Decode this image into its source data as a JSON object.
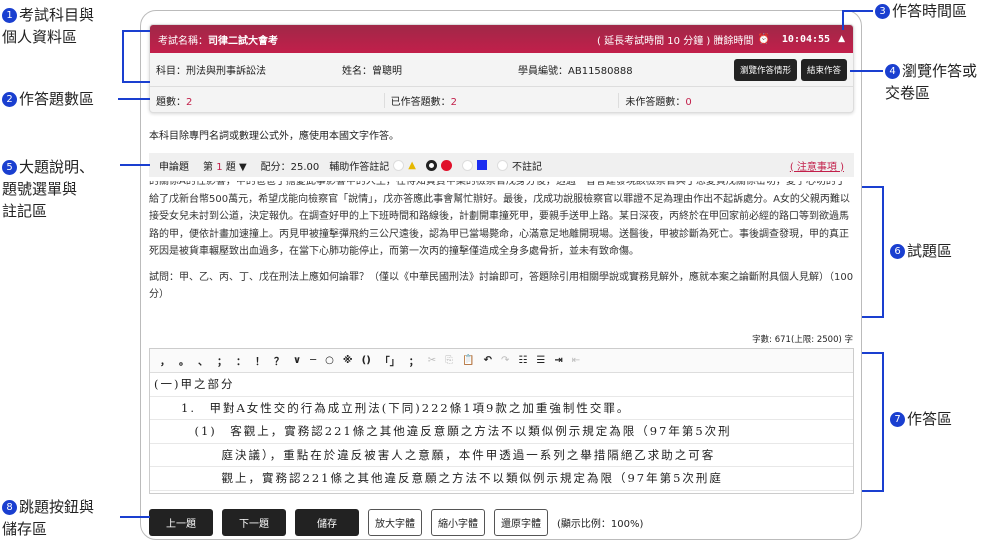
{
  "header": {
    "exam_label": "考試名稱：",
    "exam_name": "司律二試大會考",
    "extend_note": "( 延長考試時間 10 分鐘 ) 賸餘時間",
    "alarm_icon": "⏰",
    "timer": "10:04:55",
    "collapse_icon": "▲"
  },
  "info": {
    "subject": "科目：刑法與刑事訴訟法",
    "name": "姓名：曾聰明",
    "student_id": "學員編號：AB11580888",
    "review_button": "瀏覽作答情形",
    "finish_button": "結束作答"
  },
  "counts": {
    "total_label": "題數：",
    "total": "2",
    "answered_label": "已作答題數：",
    "answered": "2",
    "unanswered_label": "未作答題數：",
    "unanswered": "0"
  },
  "note": "本科目除專門名詞或數理公式外，應使用本國文字作答。",
  "question_bar": {
    "type": "申論題",
    "q_prefix": "第",
    "q_num": "1",
    "q_suffix": "題",
    "score": "配分：25.00",
    "mark_label": "輔助作答註記",
    "no_mark": "不註記",
    "notice": "( 注意事項 )"
  },
  "question": {
    "paragraphs": [
      "的關係A的性影響，甲的爸爸丁擔憂此事影響甲的人生，在得知負責甲案的檢察官戊身分後，透過一普會建發現該檢察官與丁思愛買戊關係密切，愛子心切的丁給了戊新台幣500萬元，希望戊能向檢察官「說情」，戊亦答應此事會幫忙辦好。最後，戊成功說服檢察官以罪證不足為理由作出不起訴處分。A女的父親丙難以接受女兒未討到公道，決定報仇。在調查好甲的上下班時間和路線後，計劃開車撞死甲，要親手送甲上路。某日深夜，丙終於在甲回家前必經的路口等到欲過馬路的甲，便依計畫加速撞上。丙見甲被撞擊彈飛約三公尺遠後，認為甲已當場斃命，心滿意足地離開現場。送醫後，甲被診斷為死亡。事後調查發現，甲的真正死因是被貨車輾壓致出血過多，在當下心肺功能停止，而第一次丙的撞擊僅造成全身多處骨折，並未有致命傷。",
      "試問：甲、乙、丙、丁、戊在刑法上應如何論罪？（僅以《中華民國刑法》討論即可，答題除引用相關學說或實務見解外，應就本案之論斷附具個人見解）（100分）"
    ]
  },
  "word_count": "字數: 671(上限: 2500) 字",
  "toolbar": {
    "punct": [
      "，",
      "。",
      "、",
      "；",
      "：",
      "！",
      "？",
      "∨",
      "─",
      "○",
      "※",
      "()",
      "「」",
      "；"
    ],
    "icons": [
      "cut-icon",
      "copy-icon",
      "paste-icon",
      "undo-icon",
      "redo-icon",
      "numbered-list-icon",
      "bullet-list-icon",
      "indent-icon",
      "outdent-icon"
    ]
  },
  "answer_lines": [
    "(一)甲之部分",
    "　　1.　甲對A女性交的行為成立刑法(下同)222條1項9款之加重強制性交罪。",
    "　　　(1)　客觀上，實務認221條之其他違反意願之方法不以類似例示規定為限（97年第5次刑",
    "　　　　　庭決議），重點在於違反被害人之意願，本件甲透過一系列之舉措隔絕乙求助之可客",
    "　　　　　觀上，實務認221條之其他違反意願之方法不以類似例示規定為限（97年第5次刑庭"
  ],
  "bottom": {
    "prev": "上一題",
    "next": "下一題",
    "save": "儲存",
    "zoom_in": "放大字體",
    "zoom_out": "縮小字體",
    "reset": "還原字體",
    "ratio": "(顯示比例：100%)"
  },
  "annotations": {
    "a1": "考試科目與\n個人資料區",
    "a2": "作答題數區",
    "a3": "作答時間區",
    "a4": "瀏覽作答或\n交卷區",
    "a5": "大題說明、\n題號選單與\n註記區",
    "a6": "試題區",
    "a7": "作答區",
    "a8": "跳題按鈕與\n儲存區"
  },
  "colors": {
    "header": "#c21f4a",
    "accent": "#1a3fd0",
    "triangle": "#e6b800",
    "red_dot": "#e0102a",
    "blue_square": "#1a2cf0"
  }
}
